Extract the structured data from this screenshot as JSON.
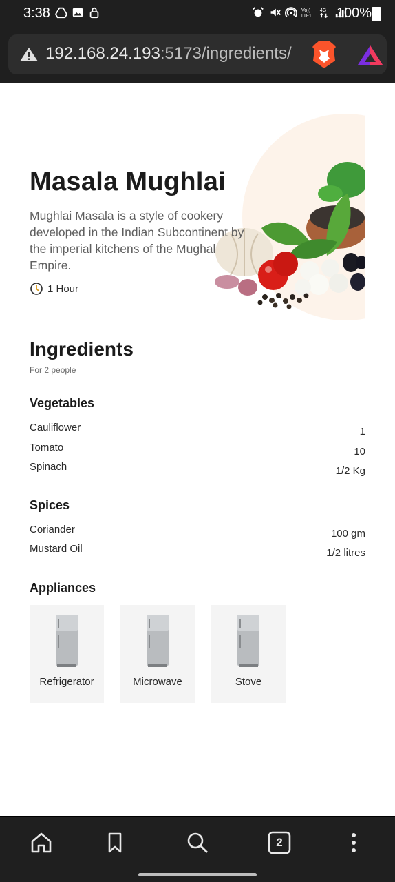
{
  "status_bar": {
    "time": "3:38",
    "battery": "100%",
    "left_icons": [
      "drive-icon",
      "image-icon",
      "lock-icon"
    ],
    "right_icons": [
      "alarm-icon",
      "vibrate-mute-icon",
      "hotspot-icon",
      "volte-icon",
      "4g-icon",
      "signal-icon",
      "battery-icon"
    ]
  },
  "browser": {
    "url_host": "192.168.24.193",
    "url_path": ":5173/ingredients/",
    "warning_icon": "warning-icon",
    "brave_icon": "brave-lion-icon",
    "rewards_icon": "brave-rewards-icon"
  },
  "recipe": {
    "title": "Masala Mughlai",
    "description": "Mughlai Masala is a style of cookery developed in the Indian Subcontinent by the imperial kitchens of the Mughal Empire.",
    "time_label": "1 Hour",
    "accent": "#fdf3ea"
  },
  "ingredients": {
    "heading": "Ingredients",
    "servings": "For 2 people",
    "sections": [
      {
        "title": "Vegetables",
        "items": [
          {
            "name": "Cauliflower",
            "qty": "1"
          },
          {
            "name": "Tomato",
            "qty": "10"
          },
          {
            "name": "Spinach",
            "qty": "1/2 Kg"
          }
        ]
      },
      {
        "title": "Spices",
        "items": [
          {
            "name": "Coriander",
            "qty": "100 gm"
          },
          {
            "name": "Mustard Oil",
            "qty": "1/2 litres"
          }
        ]
      }
    ]
  },
  "appliances": {
    "title": "Appliances",
    "items": [
      {
        "label": "Refrigerator"
      },
      {
        "label": "Microwave"
      },
      {
        "label": "Stove"
      }
    ]
  },
  "bottom_nav": {
    "items": [
      "home-icon",
      "bookmark-icon",
      "search-icon",
      "tabs-icon",
      "more-icon"
    ],
    "tab_count": "2"
  }
}
